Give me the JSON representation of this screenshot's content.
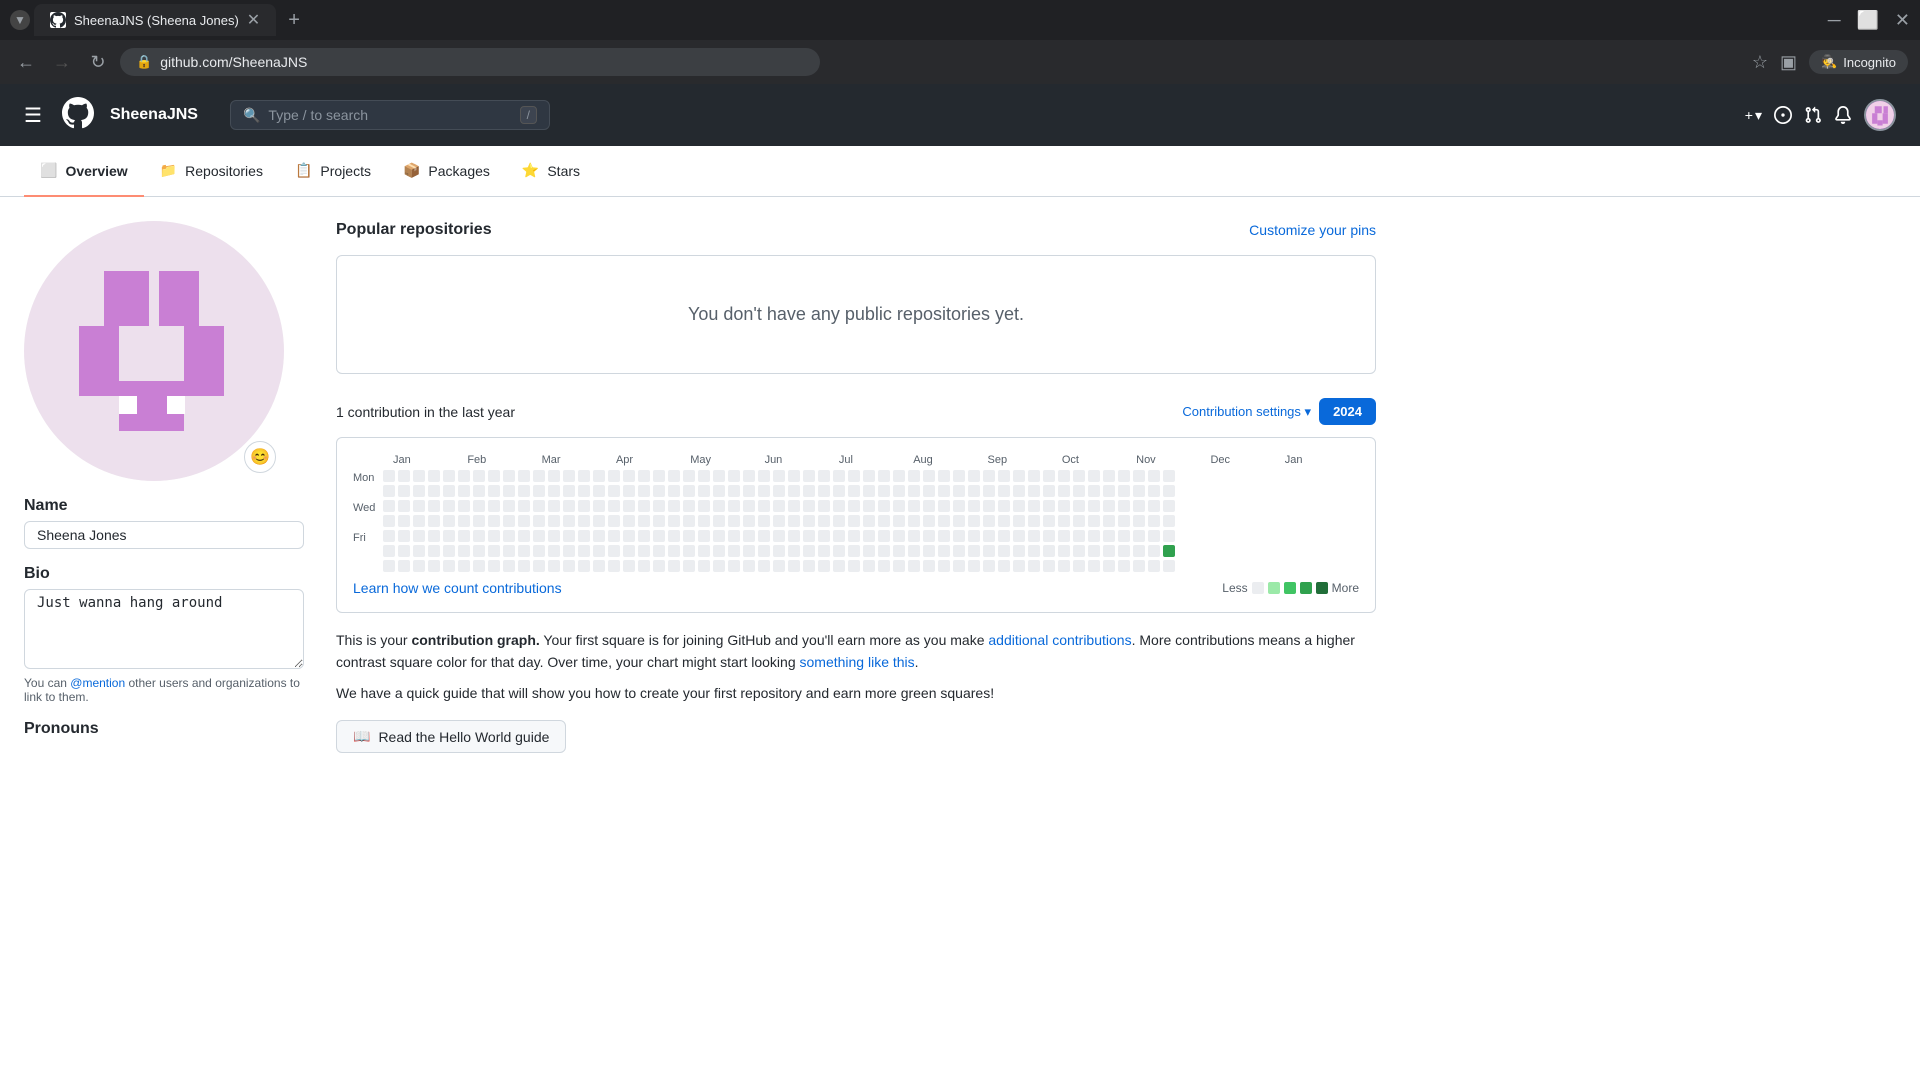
{
  "browser": {
    "tab_title": "SheenaJNS (Sheena Jones)",
    "url": "github.com/SheenaJNS",
    "incognito_label": "Incognito"
  },
  "github": {
    "logo_text": "⬛",
    "username": "SheenaJNS",
    "search_placeholder": "Type / to search",
    "nav_items": [
      {
        "icon": "📋",
        "label": "Overview"
      },
      {
        "icon": "📁",
        "label": "Repositories"
      },
      {
        "icon": "📦",
        "label": "Projects"
      },
      {
        "icon": "📦",
        "label": "Packages"
      },
      {
        "icon": "⭐",
        "label": "Stars"
      }
    ],
    "sidebar": {
      "name_label": "Name",
      "name_value": "Sheena Jones",
      "bio_label": "Bio",
      "bio_value": "Just wanna hang around",
      "pronouns_label": "Pronouns",
      "field_hint": "You can @mention other users and organizations to link to them."
    },
    "popular_repos": {
      "title": "Popular repositories",
      "customize_label": "Customize your pins",
      "empty_message": "You don't have any public repositories yet."
    },
    "contributions": {
      "summary": "1 contribution in the last year",
      "settings_label": "Contribution settings",
      "settings_chevron": "▾",
      "year_label": "2024",
      "months": [
        "Jan",
        "Feb",
        "Mar",
        "Apr",
        "May",
        "Jun",
        "Jul",
        "Aug",
        "Sep",
        "Oct",
        "Nov",
        "Dec",
        "Jan"
      ],
      "day_labels": [
        "Mon",
        "",
        "Wed",
        "",
        "Fri"
      ],
      "learn_link": "Learn how we count contributions",
      "legend_less": "Less",
      "legend_more": "More",
      "info_text_1": "This is your",
      "info_bold": "contribution graph.",
      "info_text_2": " Your first square is for joining GitHub and you'll earn more as you make ",
      "info_link1": "additional contributions",
      "info_text_3": ". More contributions means a higher contrast square color for that day. Over time, your chart might start looking ",
      "info_link2": "something like this",
      "info_text_4": ".",
      "guide_text": "We have a quick guide that will show you how to create your first repository and earn more green squares!",
      "hello_world_btn": "Read the Hello World guide"
    }
  }
}
